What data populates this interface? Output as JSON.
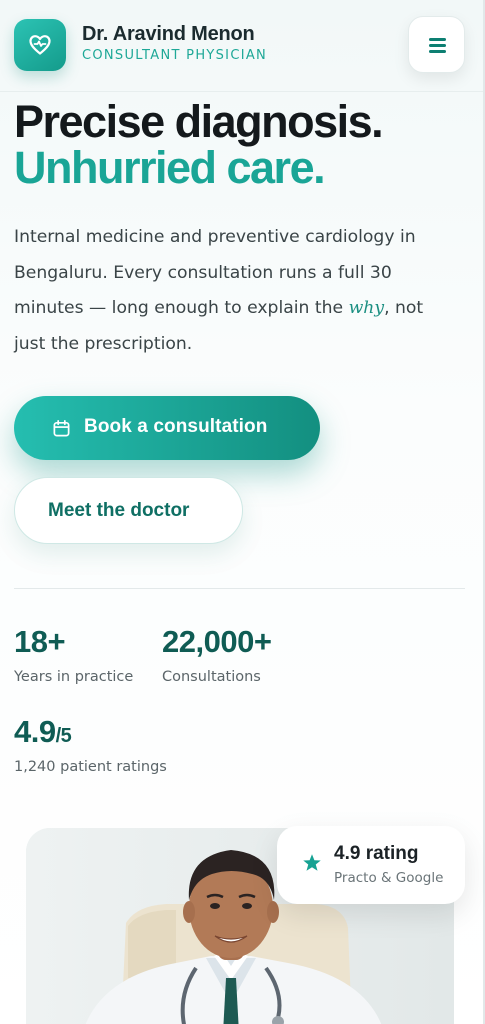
{
  "header": {
    "doctor_name": "Dr. Aravind Menon",
    "doctor_title": "CONSULTANT PHYSICIAN",
    "logo_icon": "heart-pulse-icon",
    "menu_icon": "hamburger-menu-icon"
  },
  "hero": {
    "headline_line1": "Precise diagnosis.",
    "headline_line2": "Unhurried care.",
    "lead_before": "Internal medicine and preventive cardiology in Bengaluru. Every consultation runs a full 30 minutes — long enough to explain the ",
    "lead_em": "why",
    "lead_after": ", not just the prescription.",
    "primary_button": "Book a consultation",
    "primary_button_icon": "calendar-icon",
    "secondary_button": "Meet the doctor"
  },
  "stats": [
    {
      "value": "18+",
      "suffix": "",
      "label": "Years in practice"
    },
    {
      "value": "22,000+",
      "suffix": "",
      "label": "Consultations"
    },
    {
      "value": "4.9",
      "suffix": "/5",
      "label": "1,240 patient ratings"
    }
  ],
  "rating_chip": {
    "title": "4.9 rating",
    "source": "Practo & Google",
    "icon": "star-icon"
  },
  "colors": {
    "accent": "#1aa596",
    "accent_dark": "#0f5c54",
    "text": "#14191c"
  }
}
